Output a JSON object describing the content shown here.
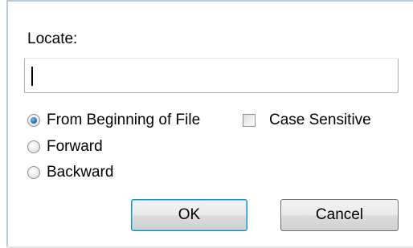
{
  "locate": {
    "label": "Locate:",
    "value": ""
  },
  "direction": {
    "options": [
      {
        "label": "From Beginning of File",
        "checked": true
      },
      {
        "label": "Forward",
        "checked": false
      },
      {
        "label": "Backward",
        "checked": false
      }
    ]
  },
  "case_sensitive": {
    "label": "Case Sensitive",
    "checked": false
  },
  "buttons": {
    "ok_label": "OK",
    "cancel_label": "Cancel"
  }
}
